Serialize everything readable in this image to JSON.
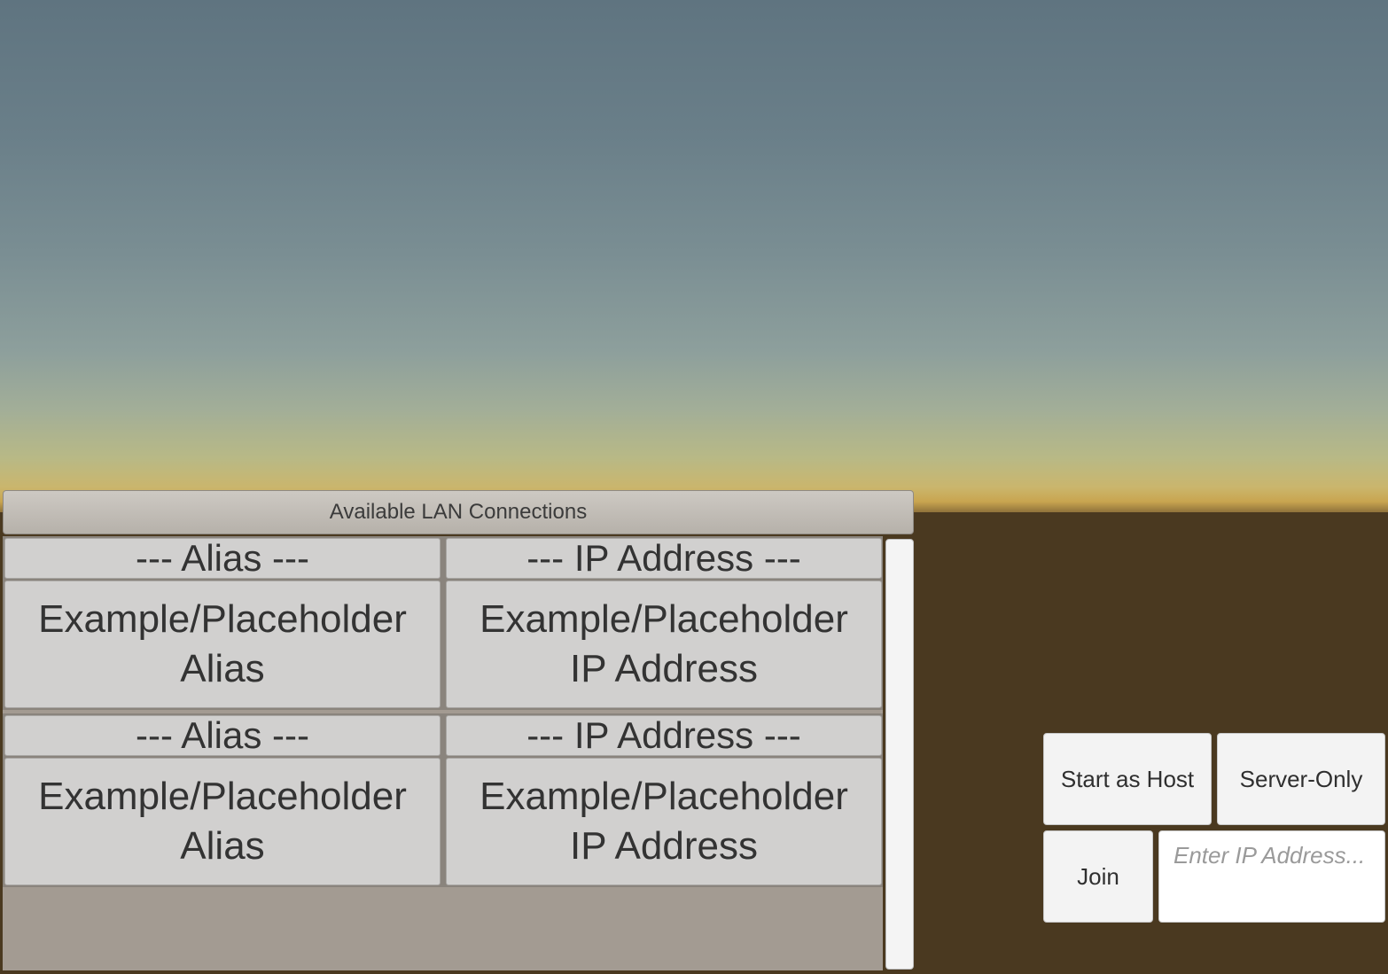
{
  "lan_panel": {
    "title": "Available LAN Connections",
    "entries": [
      {
        "alias_header": "--- Alias ---",
        "ip_header": "--- IP Address ---",
        "alias_value": "Example/Placeholder\nAlias",
        "ip_value": "Example/Placeholder\nIP Address"
      },
      {
        "alias_header": "--- Alias ---",
        "ip_header": "--- IP Address ---",
        "alias_value": "Example/Placeholder\nAlias",
        "ip_value": "Example/Placeholder\nIP Address"
      }
    ]
  },
  "controls": {
    "start_host_label": "Start as Host",
    "server_only_label": "Server-Only",
    "join_label": "Join",
    "ip_input_placeholder": "Enter IP Address...",
    "ip_input_value": ""
  },
  "colors": {
    "sky_top": "#5f7480",
    "horizon": "#cab66d",
    "ground": "#4a3920",
    "button_bg": "#f3f3f3",
    "cell_bg": "#d1d0cf"
  }
}
